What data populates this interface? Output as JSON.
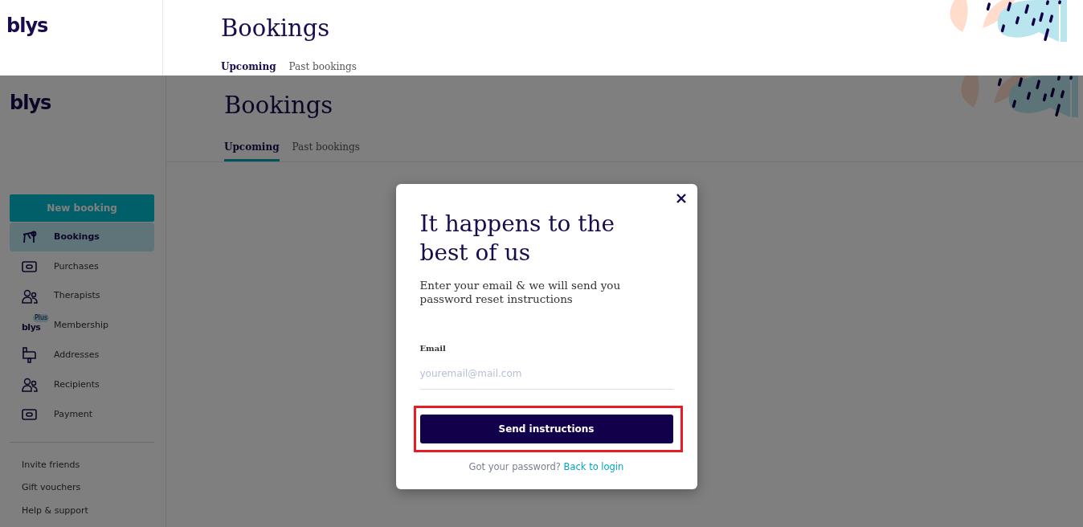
{
  "top_strip": {
    "logo": "blys",
    "title": "Bookings",
    "tabs": [
      {
        "label": "Upcoming",
        "selected": true
      },
      {
        "label": "Past bookings",
        "selected": false
      }
    ]
  },
  "sidebar": {
    "logo": "blys",
    "new_booking_button": "New booking",
    "items": [
      {
        "label": "Bookings",
        "kind": "table",
        "selected": true
      },
      {
        "label": "Purchases",
        "kind": "card",
        "selected": false
      },
      {
        "label": "Therapists",
        "kind": "people",
        "selected": false
      },
      {
        "label": "Membership",
        "kind": "logo",
        "icon_text": "blys",
        "icon_badge": "Plus",
        "selected": false
      },
      {
        "label": "Addresses",
        "kind": "mailbox",
        "selected": false
      },
      {
        "label": "Recipients",
        "kind": "people",
        "selected": false
      },
      {
        "label": "Payment",
        "kind": "card",
        "selected": false
      }
    ],
    "footer_links": [
      "Invite friends",
      "Gift vouchers",
      "Help & support"
    ]
  },
  "main": {
    "title": "Bookings",
    "tabs": [
      {
        "label": "Upcoming",
        "selected": true
      },
      {
        "label": "Past bookings",
        "selected": false
      }
    ]
  },
  "modal": {
    "title": "It happens to the best of us",
    "subtitle": "Enter your email & we will send you password reset instructions",
    "email_label": "Email",
    "email_placeholder": "youremail@mail.com",
    "button": {
      "label": "Send instructions",
      "highlighted": true
    },
    "footer_text": "Got your password?",
    "footer_link": "Back to login"
  }
}
